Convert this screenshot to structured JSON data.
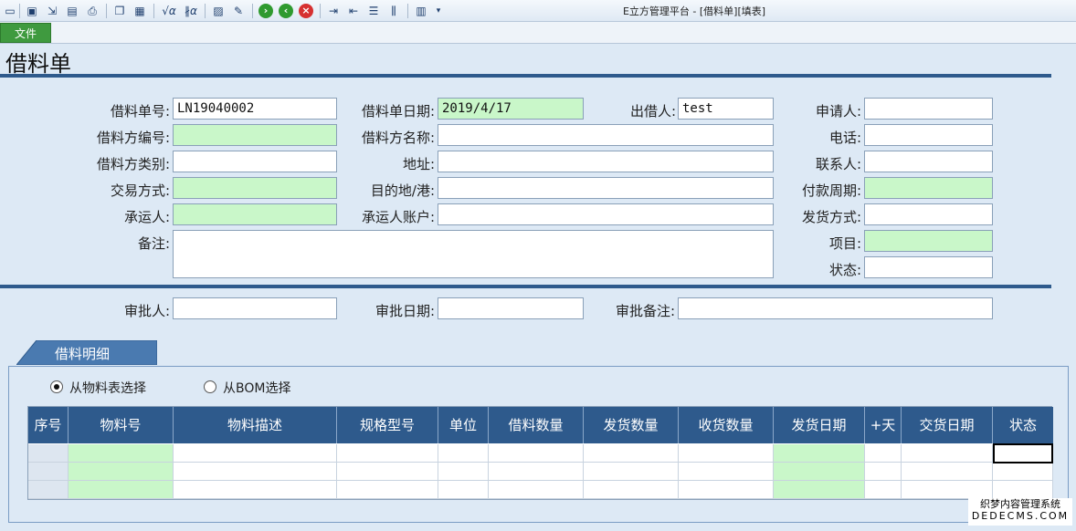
{
  "window": {
    "title": "E立方管理平台 - [借料单][填表]"
  },
  "menu": {
    "file_label": "文件"
  },
  "toolbar": {
    "icons": [
      "window-icon",
      "save-icon",
      "export-icon",
      "preview-icon",
      "print-icon",
      "copy-icon",
      "paste-icon",
      "formula-icon",
      "formula-clear-icon",
      "clipboard-icon",
      "edit-icon",
      "forward-icon",
      "back-icon",
      "cancel-icon",
      "indent-icon",
      "outdent-icon",
      "list-icon",
      "align-icon",
      "layout-icon",
      "dropdown-icon"
    ]
  },
  "page": {
    "title": "借料单"
  },
  "form": {
    "loan_no": {
      "label": "借料单号:",
      "value": "LN19040002"
    },
    "loan_date": {
      "label": "借料单日期:",
      "value": "2019/4/17"
    },
    "lender": {
      "label": "出借人:",
      "value": "test"
    },
    "applicant": {
      "label": "申请人:",
      "value": ""
    },
    "borrower_code": {
      "label": "借料方编号:",
      "value": ""
    },
    "borrower_name": {
      "label": "借料方名称:",
      "value": ""
    },
    "phone": {
      "label": "电话:",
      "value": ""
    },
    "borrower_type": {
      "label": "借料方类别:",
      "value": ""
    },
    "address": {
      "label": "地址:",
      "value": ""
    },
    "contact": {
      "label": "联系人:",
      "value": ""
    },
    "trade_mode": {
      "label": "交易方式:",
      "value": ""
    },
    "destination": {
      "label": "目的地/港:",
      "value": ""
    },
    "payment_period": {
      "label": "付款周期:",
      "value": ""
    },
    "carrier": {
      "label": "承运人:",
      "value": ""
    },
    "carrier_account": {
      "label": "承运人账户:",
      "value": ""
    },
    "shipping_method": {
      "label": "发货方式:",
      "value": ""
    },
    "remarks": {
      "label": "备注:",
      "value": ""
    },
    "project": {
      "label": "项目:",
      "value": ""
    },
    "status": {
      "label": "状态:",
      "value": ""
    }
  },
  "approval": {
    "approver": {
      "label": "审批人:",
      "value": ""
    },
    "approval_date": {
      "label": "审批日期:",
      "value": ""
    },
    "approval_note": {
      "label": "审批备注:",
      "value": ""
    }
  },
  "detail": {
    "tab_label": "借料明细",
    "radio_material": "从物料表选择",
    "radio_bom": "从BOM选择",
    "columns": [
      "序号",
      "物料号",
      "物料描述",
      "规格型号",
      "单位",
      "借料数量",
      "发货数量",
      "收货数量",
      "发货日期",
      "+天",
      "交货日期",
      "状态"
    ]
  },
  "watermark": {
    "line1": "织梦内容管理系统",
    "line2": "DEDECMS.COM"
  }
}
